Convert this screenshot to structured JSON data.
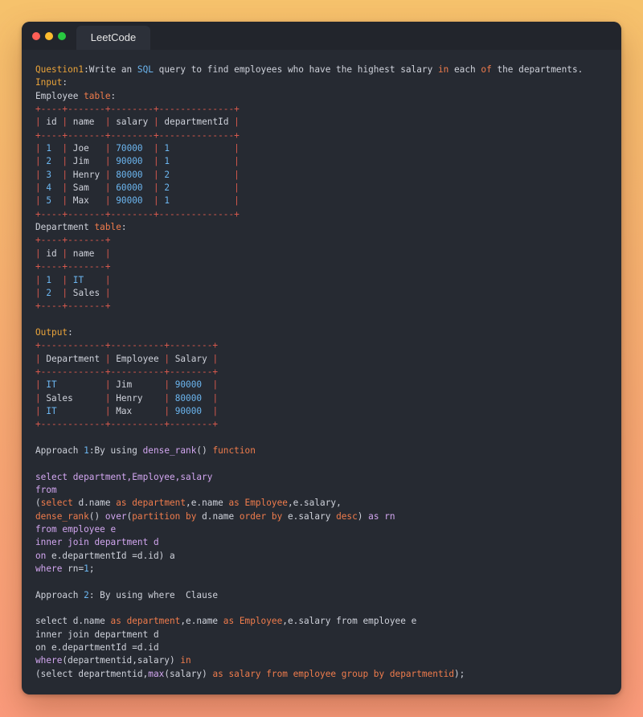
{
  "window": {
    "tab_title": "LeetCode"
  },
  "colors": {
    "keyword": "#f07c4c",
    "heading": "#e9a33a",
    "table_border": "#d8594d",
    "number": "#6cb6f0",
    "function": "#d2a6f0",
    "text": "#cfd2db",
    "background": "#262a32"
  },
  "code": {
    "lines": [
      [
        [
          "hd",
          "Question1"
        ],
        [
          "tx",
          ":Write an "
        ],
        [
          "nm",
          "SQL"
        ],
        [
          "tx",
          " query to find employees who have the highest salary "
        ],
        [
          "kw",
          "in"
        ],
        [
          "tx",
          " each "
        ],
        [
          "kw",
          "of"
        ],
        [
          "tx",
          " the departments."
        ]
      ],
      [
        [
          "hd",
          "Input"
        ],
        [
          "tx",
          ":"
        ]
      ],
      [
        [
          "tx",
          "Employee "
        ],
        [
          "kw",
          "table"
        ],
        [
          "tx",
          ":"
        ]
      ],
      [
        [
          "tb",
          "+----+-------+--------+--------------+"
        ]
      ],
      [
        [
          "tb",
          "| "
        ],
        [
          "tx",
          "id"
        ],
        [
          "tb",
          " | "
        ],
        [
          "tx",
          "name "
        ],
        [
          "tb",
          " | "
        ],
        [
          "tx",
          "salary"
        ],
        [
          "tb",
          " | "
        ],
        [
          "tx",
          "departmentId"
        ],
        [
          "tb",
          " |"
        ]
      ],
      [
        [
          "tb",
          "+----+-------+--------+--------------+"
        ]
      ],
      [
        [
          "tb",
          "| "
        ],
        [
          "nm",
          "1 "
        ],
        [
          "tb",
          " | "
        ],
        [
          "tx",
          "Joe  "
        ],
        [
          "tb",
          " | "
        ],
        [
          "nm",
          "70000 "
        ],
        [
          "tb",
          " | "
        ],
        [
          "nm",
          "1           "
        ],
        [
          "tb",
          " |"
        ]
      ],
      [
        [
          "tb",
          "| "
        ],
        [
          "nm",
          "2 "
        ],
        [
          "tb",
          " | "
        ],
        [
          "tx",
          "Jim  "
        ],
        [
          "tb",
          " | "
        ],
        [
          "nm",
          "90000 "
        ],
        [
          "tb",
          " | "
        ],
        [
          "nm",
          "1           "
        ],
        [
          "tb",
          " |"
        ]
      ],
      [
        [
          "tb",
          "| "
        ],
        [
          "nm",
          "3 "
        ],
        [
          "tb",
          " | "
        ],
        [
          "tx",
          "Henry"
        ],
        [
          "tb",
          " | "
        ],
        [
          "nm",
          "80000 "
        ],
        [
          "tb",
          " | "
        ],
        [
          "nm",
          "2           "
        ],
        [
          "tb",
          " |"
        ]
      ],
      [
        [
          "tb",
          "| "
        ],
        [
          "nm",
          "4 "
        ],
        [
          "tb",
          " | "
        ],
        [
          "tx",
          "Sam  "
        ],
        [
          "tb",
          " | "
        ],
        [
          "nm",
          "60000 "
        ],
        [
          "tb",
          " | "
        ],
        [
          "nm",
          "2           "
        ],
        [
          "tb",
          " |"
        ]
      ],
      [
        [
          "tb",
          "| "
        ],
        [
          "nm",
          "5 "
        ],
        [
          "tb",
          " | "
        ],
        [
          "tx",
          "Max  "
        ],
        [
          "tb",
          " | "
        ],
        [
          "nm",
          "90000 "
        ],
        [
          "tb",
          " | "
        ],
        [
          "nm",
          "1           "
        ],
        [
          "tb",
          " |"
        ]
      ],
      [
        [
          "tb",
          "+----+-------+--------+--------------+"
        ]
      ],
      [
        [
          "tx",
          "Department "
        ],
        [
          "kw",
          "table"
        ],
        [
          "tx",
          ":"
        ]
      ],
      [
        [
          "tb",
          "+----+-------+"
        ]
      ],
      [
        [
          "tb",
          "| "
        ],
        [
          "tx",
          "id"
        ],
        [
          "tb",
          " | "
        ],
        [
          "tx",
          "name "
        ],
        [
          "tb",
          " |"
        ]
      ],
      [
        [
          "tb",
          "+----+-------+"
        ]
      ],
      [
        [
          "tb",
          "| "
        ],
        [
          "nm",
          "1 "
        ],
        [
          "tb",
          " | "
        ],
        [
          "nm",
          "IT   "
        ],
        [
          "tb",
          " |"
        ]
      ],
      [
        [
          "tb",
          "| "
        ],
        [
          "nm",
          "2 "
        ],
        [
          "tb",
          " | "
        ],
        [
          "tx",
          "Sales"
        ],
        [
          "tb",
          " |"
        ]
      ],
      [
        [
          "tb",
          "+----+-------+"
        ]
      ],
      [],
      [
        [
          "hd",
          "Output"
        ],
        [
          "tx",
          ":"
        ]
      ],
      [
        [
          "tb",
          "+------------+----------+--------+"
        ]
      ],
      [
        [
          "tb",
          "| "
        ],
        [
          "tx",
          "Department"
        ],
        [
          "tb",
          " | "
        ],
        [
          "tx",
          "Employee"
        ],
        [
          "tb",
          " | "
        ],
        [
          "tx",
          "Salary"
        ],
        [
          "tb",
          " |"
        ]
      ],
      [
        [
          "tb",
          "+------------+----------+--------+"
        ]
      ],
      [
        [
          "tb",
          "| "
        ],
        [
          "nm",
          "IT        "
        ],
        [
          "tb",
          " | "
        ],
        [
          "tx",
          "Jim     "
        ],
        [
          "tb",
          " | "
        ],
        [
          "nm",
          "90000 "
        ],
        [
          "tb",
          " |"
        ]
      ],
      [
        [
          "tb",
          "| "
        ],
        [
          "tx",
          "Sales     "
        ],
        [
          "tb",
          " | "
        ],
        [
          "tx",
          "Henry   "
        ],
        [
          "tb",
          " | "
        ],
        [
          "nm",
          "80000 "
        ],
        [
          "tb",
          " |"
        ]
      ],
      [
        [
          "tb",
          "| "
        ],
        [
          "nm",
          "IT        "
        ],
        [
          "tb",
          " | "
        ],
        [
          "tx",
          "Max     "
        ],
        [
          "tb",
          " | "
        ],
        [
          "nm",
          "90000 "
        ],
        [
          "tb",
          " |"
        ]
      ],
      [
        [
          "tb",
          "+------------+----------+--------+"
        ]
      ],
      [],
      [
        [
          "tx",
          "Approach "
        ],
        [
          "nm",
          "1"
        ],
        [
          "tx",
          ":By using "
        ],
        [
          "fn",
          "dense_rank"
        ],
        [
          "tx",
          "() "
        ],
        [
          "kw",
          "function"
        ]
      ],
      [],
      [
        [
          "fn",
          "select department,Employee,salary"
        ]
      ],
      [
        [
          "fn",
          "from"
        ]
      ],
      [
        [
          "tx",
          "("
        ],
        [
          "kw",
          "select"
        ],
        [
          "tx",
          " d.name "
        ],
        [
          "kw",
          "as"
        ],
        [
          "tx",
          " "
        ],
        [
          "kw",
          "department"
        ],
        [
          "tx",
          ",e.name "
        ],
        [
          "kw",
          "as"
        ],
        [
          "tx",
          " "
        ],
        [
          "kw",
          "Employee"
        ],
        [
          "tx",
          ",e.salary,"
        ]
      ],
      [
        [
          "kw",
          "dense_rank"
        ],
        [
          "tx",
          "() "
        ],
        [
          "fn",
          "over"
        ],
        [
          "tx",
          "("
        ],
        [
          "kw",
          "partition by"
        ],
        [
          "tx",
          " d.name "
        ],
        [
          "kw",
          "order by"
        ],
        [
          "tx",
          " e.salary "
        ],
        [
          "kw",
          "desc"
        ],
        [
          "tx",
          ") "
        ],
        [
          "fn",
          "as rn"
        ]
      ],
      [
        [
          "fn",
          "from employee e"
        ]
      ],
      [
        [
          "fn",
          "inner join department d"
        ]
      ],
      [
        [
          "fn",
          "on"
        ],
        [
          "tx",
          " e.departmentId =d.id) a"
        ]
      ],
      [
        [
          "fn",
          "where"
        ],
        [
          "tx",
          " rn="
        ],
        [
          "nm",
          "1"
        ],
        [
          "tx",
          ";"
        ]
      ],
      [],
      [
        [
          "tx",
          "Approach "
        ],
        [
          "nm",
          "2"
        ],
        [
          "tx",
          ": By using where  Clause"
        ]
      ],
      [],
      [
        [
          "tx",
          "select d.name "
        ],
        [
          "kw",
          "as"
        ],
        [
          "tx",
          " "
        ],
        [
          "kw",
          "department"
        ],
        [
          "tx",
          ",e.name "
        ],
        [
          "kw",
          "as"
        ],
        [
          "tx",
          " "
        ],
        [
          "kw",
          "Employee"
        ],
        [
          "tx",
          ",e.salary from employee e"
        ]
      ],
      [
        [
          "tx",
          "inner join department d"
        ]
      ],
      [
        [
          "tx",
          "on e.departmentId =d.id"
        ]
      ],
      [
        [
          "fn",
          "where"
        ],
        [
          "tx",
          "(departmentid,salary) "
        ],
        [
          "kw",
          "in"
        ]
      ],
      [
        [
          "tx",
          "(select departmentid,"
        ],
        [
          "fn",
          "max"
        ],
        [
          "tx",
          "(salary) "
        ],
        [
          "kw",
          "as salary from employee group by departmentid"
        ],
        [
          "tx",
          ");"
        ]
      ]
    ]
  }
}
